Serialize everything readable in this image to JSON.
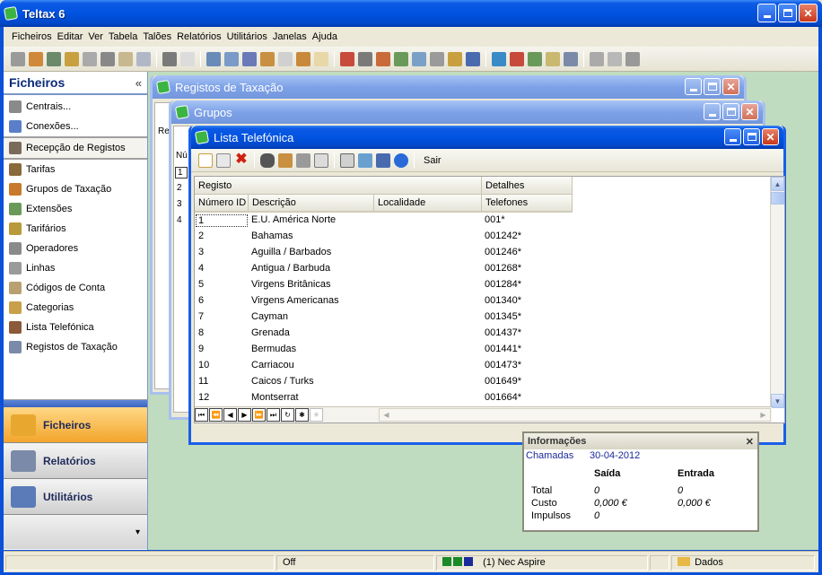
{
  "app": {
    "title": "Teltax 6"
  },
  "menu": [
    "Ficheiros",
    "Editar",
    "Ver",
    "Tabela",
    "Talões",
    "Relatórios",
    "Utilitários",
    "Janelas",
    "Ajuda"
  ],
  "toolbar_icons": [
    "tb-1",
    "tb-2",
    "tb-3",
    "tb-4",
    "tb-5",
    "tb-6",
    "tb-7",
    "tb-8",
    "tb-9",
    "tb-10",
    "tb-11",
    "tb-12",
    "tb-13",
    "tb-14",
    "tb-15",
    "tb-16",
    "tb-17",
    "tb-18",
    "tb-19",
    "tb-20",
    "tb-21",
    "tb-22",
    "tb-23",
    "tb-24",
    "tb-25",
    "tb-26",
    "tb-27",
    "tb-28",
    "tb-29",
    "tb-30",
    "tb-31",
    "tb-32",
    "tb-33"
  ],
  "nav": {
    "header": "Ficheiros",
    "collapse": "«",
    "group1": [
      {
        "label": "Centrais...",
        "icon": "phone-icon",
        "color": "#8a8a8a"
      },
      {
        "label": "Conexões...",
        "icon": "connection-icon",
        "color": "#5a7fc8"
      }
    ],
    "selected": {
      "label": "Recepção de Registos",
      "icon": "reception-icon",
      "color": "#7a6a5a"
    },
    "group2": [
      {
        "label": "Tarifas",
        "icon": "tariff-icon",
        "color": "#8a6a3a"
      },
      {
        "label": "Grupos de Taxação",
        "icon": "group-icon",
        "color": "#c87a2a"
      },
      {
        "label": "Extensões",
        "icon": "extension-icon",
        "color": "#6a9a5a"
      },
      {
        "label": "Tarifários",
        "icon": "tariff-plan-icon",
        "color": "#b89a3a"
      },
      {
        "label": "Operadores",
        "icon": "operator-icon",
        "color": "#8a8a8a"
      },
      {
        "label": "Linhas",
        "icon": "line-icon",
        "color": "#9a9a9a"
      },
      {
        "label": "Códigos de Conta",
        "icon": "account-code-icon",
        "color": "#b8a070"
      },
      {
        "label": "Categorias",
        "icon": "category-icon",
        "color": "#c8a04a"
      },
      {
        "label": "Lista Telefónica",
        "icon": "phonebook-icon",
        "color": "#8a5a3a"
      },
      {
        "label": "Registos de Taxação",
        "icon": "billing-records-icon",
        "color": "#7a8aa8"
      }
    ],
    "big_buttons": [
      {
        "label": "Ficheiros",
        "icon": "folder-icon",
        "active": true
      },
      {
        "label": "Relatórios",
        "icon": "printer-icon",
        "active": false
      },
      {
        "label": "Utilitários",
        "icon": "utilities-icon",
        "active": false
      }
    ],
    "more": "▾"
  },
  "windows": {
    "registos": {
      "title": "Registos de Taxação"
    },
    "grupos": {
      "title": "Grupos"
    },
    "lista": {
      "title": "Lista Telefónica",
      "exit_label": "Sair",
      "group_headers": {
        "registo": "Registo",
        "detalhes": "Detalhes"
      },
      "columns": {
        "id": "Número ID",
        "descricao": "Descrição",
        "localidade": "Localidade",
        "telefones": "Telefones"
      },
      "rows": [
        {
          "id": "1",
          "desc": "E.U. América Norte",
          "tel": "001*"
        },
        {
          "id": "2",
          "desc": "Bahamas",
          "tel": "001242*"
        },
        {
          "id": "3",
          "desc": "Aguilla / Barbados",
          "tel": "001246*"
        },
        {
          "id": "4",
          "desc": "Antigua / Barbuda",
          "tel": "001268*"
        },
        {
          "id": "5",
          "desc": "Virgens Britânicas",
          "tel": "001284*"
        },
        {
          "id": "6",
          "desc": "Virgens Americanas",
          "tel": "001340*"
        },
        {
          "id": "7",
          "desc": "Cayman",
          "tel": "001345*"
        },
        {
          "id": "8",
          "desc": "Grenada",
          "tel": "001437*"
        },
        {
          "id": "9",
          "desc": "Bermudas",
          "tel": "001441*"
        },
        {
          "id": "10",
          "desc": "Carriacou",
          "tel": "001473*"
        },
        {
          "id": "11",
          "desc": "Caicos / Turks",
          "tel": "001649*"
        },
        {
          "id": "12",
          "desc": "Montserrat",
          "tel": "001664*"
        }
      ]
    }
  },
  "behind_rows": [
    "1",
    "2",
    "3",
    "4"
  ],
  "behind_label": "Re",
  "behind_label2": "Nú",
  "info": {
    "title": "Informações",
    "close": "✕",
    "calls_label": "Chamadas",
    "date": "30-04-2012",
    "col_out": "Saída",
    "col_in": "Entrada",
    "rows": [
      {
        "label": "Total",
        "out": "0",
        "in": "0"
      },
      {
        "label": "Custo",
        "out": "0,000 €",
        "in": "0,000 €"
      },
      {
        "label": "Impulsos",
        "out": "0",
        "in": ""
      }
    ]
  },
  "status": {
    "mode": "Off",
    "device": "(1)  Nec Aspire",
    "data": "Dados"
  }
}
